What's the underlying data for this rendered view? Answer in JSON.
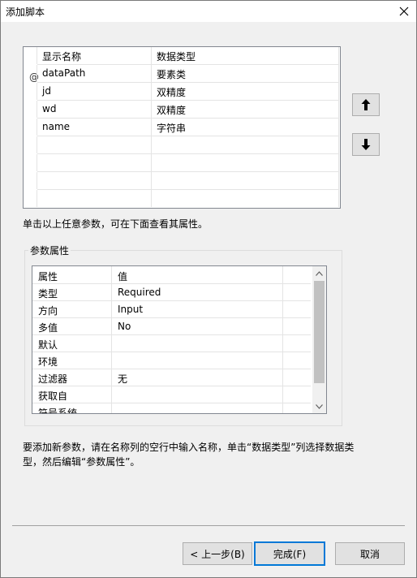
{
  "window": {
    "title": "添加脚本"
  },
  "params_grid": {
    "headers": [
      "显示名称",
      "数据类型"
    ],
    "current_row_marker": "@",
    "rows": [
      {
        "name": "dataPath",
        "type": "要素类"
      },
      {
        "name": "jd",
        "type": "双精度"
      },
      {
        "name": "wd",
        "type": "双精度"
      },
      {
        "name": "name",
        "type": "字符串"
      }
    ]
  },
  "move_buttons": {
    "up_icon": "arrow-up-icon",
    "down_icon": "arrow-down-icon"
  },
  "hint_click": "单击以上任意参数，可在下面查看其属性。",
  "properties": {
    "title": "参数属性",
    "headers": [
      "属性",
      "值"
    ],
    "rows": [
      {
        "key": "类型",
        "value": "Required"
      },
      {
        "key": "方向",
        "value": "Input"
      },
      {
        "key": "多值",
        "value": "No"
      },
      {
        "key": "默认",
        "value": ""
      },
      {
        "key": "环境",
        "value": ""
      },
      {
        "key": "过滤器",
        "value": "无"
      },
      {
        "key": "获取自",
        "value": ""
      },
      {
        "key": "符号系统",
        "value": ""
      }
    ]
  },
  "hint_add": "要添加新参数，请在名称列的空行中输入名称，单击“数据类型”列选择数据类型，然后编辑“参数属性”。",
  "buttons": {
    "back": "< 上一步(B)",
    "finish": "完成(F)",
    "cancel": "取消"
  },
  "colors": {
    "accent": "#0078d7",
    "button_bg": "#e1e1e1",
    "window_bg": "#f0f0f0"
  }
}
